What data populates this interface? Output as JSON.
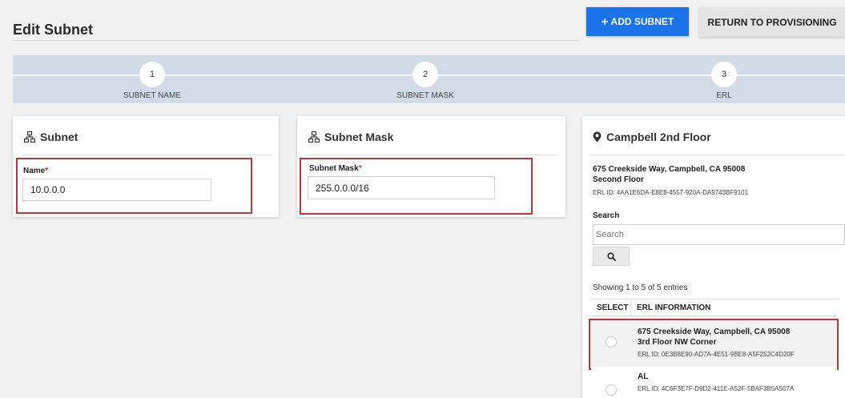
{
  "header": {
    "title": "Edit Subnet",
    "add_button": {
      "icon": "plus-icon",
      "label": "ADD SUBNET"
    },
    "return_button": "RETURN TO PROVISIONING"
  },
  "stepper": {
    "steps": [
      {
        "number": "1",
        "label": "SUBNET NAME"
      },
      {
        "number": "2",
        "label": "SUBNET MASK"
      },
      {
        "number": "3",
        "label": "ERL"
      }
    ]
  },
  "subnet_card": {
    "icon": "network-icon",
    "title": "Subnet",
    "field_label": "Name",
    "required_mark": "*",
    "value": "10.0.0.0"
  },
  "mask_card": {
    "icon": "network-icon",
    "title": "Subnet Mask",
    "field_label": "Subnet Mask",
    "required_mark": "*",
    "value": "255.0.0.0/16"
  },
  "erl_card": {
    "icon": "map-pin-icon",
    "title": "Campbell 2nd Floor",
    "address": "675 Creekside Way, Campbell, CA 95008",
    "location": "Second Floor",
    "erl_id": "ERL ID: 4AA1E6DA-E8E8-4557-920A-DA9743BF9101",
    "search_label": "Search",
    "search_placeholder": "Search",
    "search_icon": "search-icon",
    "entries_info": "Showing 1 to 5 of 5 entries",
    "columns": [
      "SELECT",
      "ERL INFORMATION"
    ],
    "rows": [
      {
        "address": "675 Creekside Way, Campbell, CA 95008",
        "location": "3rd Floor NW Corner",
        "erl_id": "ERL ID: 0E3B8E90-AD7A-4E51-9BE8-A5F252C4D20F"
      },
      {
        "address": "AL",
        "erl_id": "ERL ID: 4C6F3E7F-D9D2-411E-A52F-5BAF3B5A507A"
      }
    ]
  },
  "colors": {
    "primary": "#1a73e8",
    "highlight": "#b23a3a",
    "stepper_bg": "#d3dbe6",
    "required": "#d32f2f"
  }
}
